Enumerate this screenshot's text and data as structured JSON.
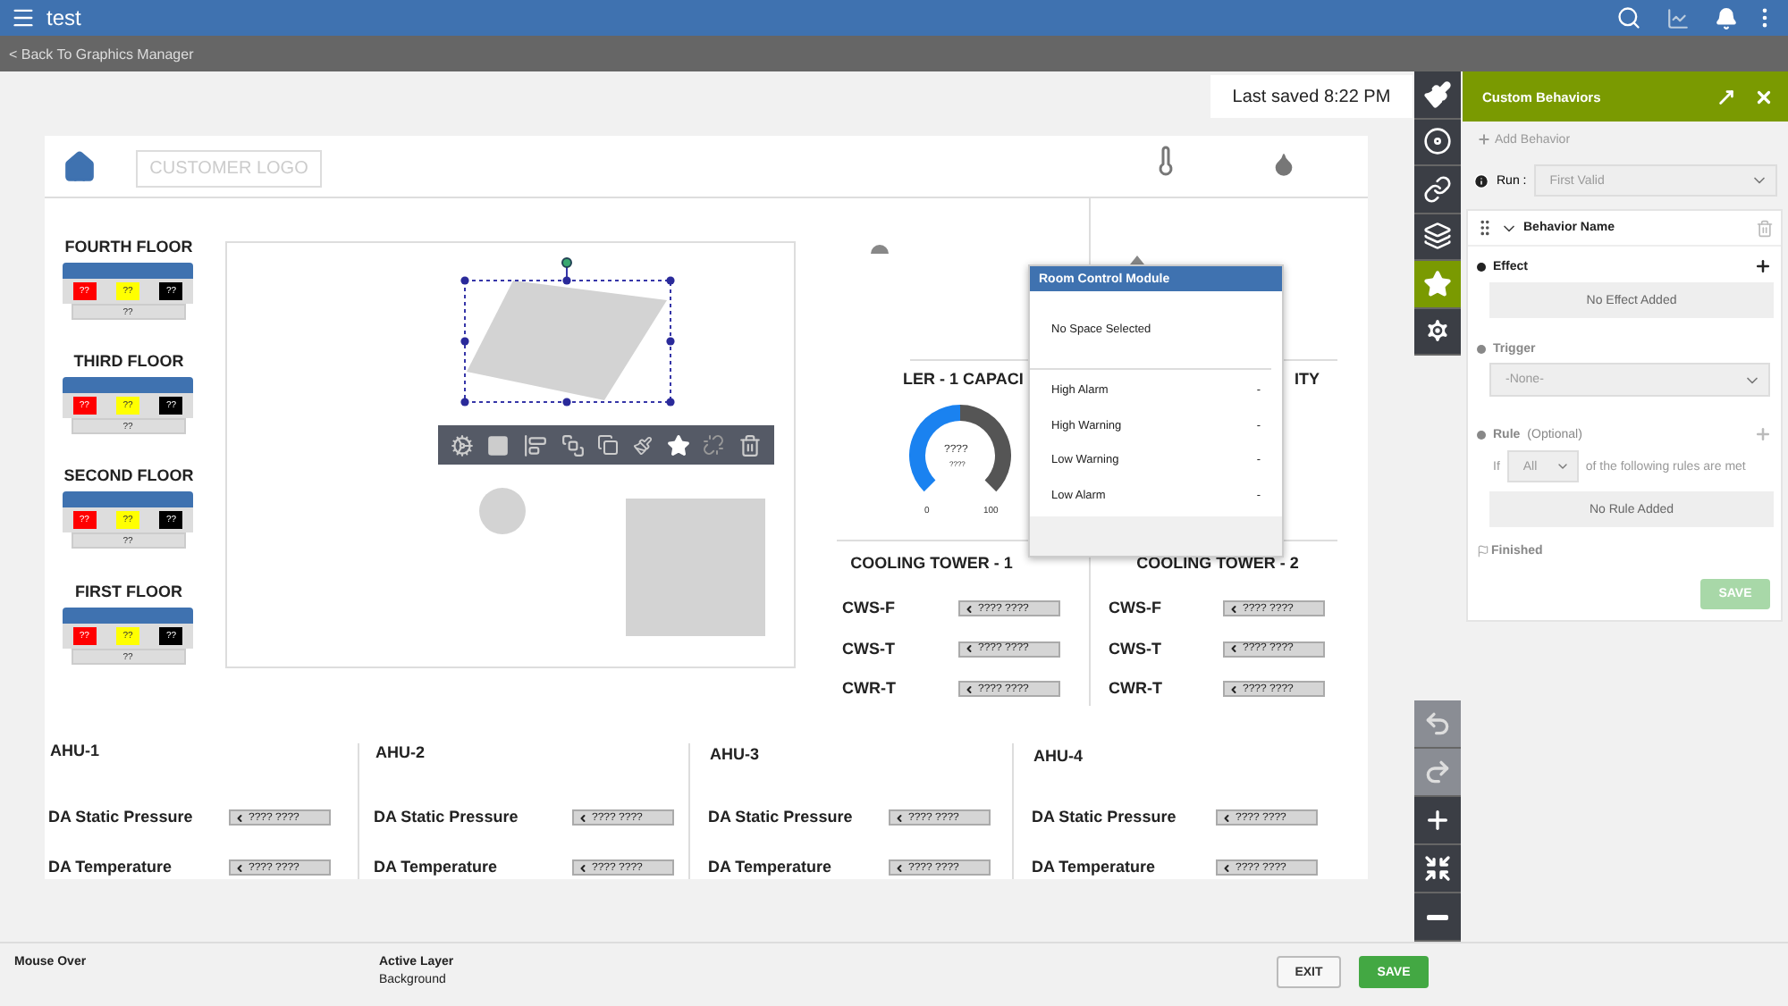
{
  "app_bar": {
    "title": "test"
  },
  "back_link": "< Back To Graphics Manager",
  "last_saved": "Last saved 8:22 PM",
  "canvas": {
    "logo": "CUSTOMER LOGO",
    "floors": [
      {
        "name": "FOURTH FLOOR",
        "bottom": "??",
        "cells": [
          {
            "text": "??",
            "color": "#ff0000"
          },
          {
            "text": "??",
            "color": "#ffff00"
          },
          {
            "text": "??",
            "color": "#000000"
          }
        ]
      },
      {
        "name": "THIRD FLOOR",
        "bottom": "??",
        "cells": [
          {
            "text": "??",
            "color": "#ff0000"
          },
          {
            "text": "??",
            "color": "#ffff00"
          },
          {
            "text": "??",
            "color": "#000000"
          }
        ]
      },
      {
        "name": "SECOND FLOOR",
        "bottom": "??",
        "cells": [
          {
            "text": "??",
            "color": "#ff0000"
          },
          {
            "text": "??",
            "color": "#ffff00"
          },
          {
            "text": "??",
            "color": "#000000"
          }
        ]
      },
      {
        "name": "FIRST FLOOR",
        "bottom": "??",
        "cells": [
          {
            "text": "??",
            "color": "#ff0000"
          },
          {
            "text": "??",
            "color": "#ffff00"
          },
          {
            "text": "??",
            "color": "#000000"
          }
        ]
      }
    ],
    "chiller_title_left": "LER - 1 CAPACI",
    "chiller_title_right": "ITY",
    "gauge": {
      "value": "????",
      "unit": "????",
      "min": "0",
      "max": "100",
      "level": 0.5
    },
    "towers": [
      {
        "title": "COOLING TOWER - 1",
        "rows": [
          {
            "label": "CWS-F",
            "value": "???? ????"
          },
          {
            "label": "CWS-T",
            "value": "???? ????"
          },
          {
            "label": "CWR-T",
            "value": "???? ????"
          }
        ]
      },
      {
        "title": "COOLING TOWER - 2",
        "rows": [
          {
            "label": "CWS-F",
            "value": "???? ????"
          },
          {
            "label": "CWS-T",
            "value": "???? ????"
          },
          {
            "label": "CWR-T",
            "value": "???? ????"
          }
        ]
      }
    ],
    "popup": {
      "title": "Room Control Module",
      "message": "No Space Selected",
      "rows": [
        {
          "label": "High Alarm",
          "value": "-"
        },
        {
          "label": "High Warning",
          "value": "-"
        },
        {
          "label": "Low Warning",
          "value": "-"
        },
        {
          "label": "Low Alarm",
          "value": "-"
        }
      ]
    },
    "ahus": [
      {
        "title": "AHU-1",
        "rows": [
          {
            "label": "DA Static Pressure",
            "value": "???? ????"
          },
          {
            "label": "DA Temperature",
            "value": "???? ????"
          }
        ]
      },
      {
        "title": "AHU-2",
        "rows": [
          {
            "label": "DA Static Pressure",
            "value": "???? ????"
          },
          {
            "label": "DA Temperature",
            "value": "???? ????"
          }
        ]
      },
      {
        "title": "AHU-3",
        "rows": [
          {
            "label": "DA Static Pressure",
            "value": "???? ????"
          },
          {
            "label": "DA Temperature",
            "value": "???? ????"
          }
        ]
      },
      {
        "title": "AHU-4",
        "rows": [
          {
            "label": "DA Static Pressure",
            "value": "???? ????"
          },
          {
            "label": "DA Temperature",
            "value": "???? ????"
          }
        ]
      }
    ]
  },
  "tools": [
    {
      "kind": "brush",
      "selected": false
    },
    {
      "kind": "ring",
      "selected": false
    },
    {
      "kind": "link",
      "selected": false
    },
    {
      "kind": "layers",
      "selected": false
    },
    {
      "kind": "star",
      "selected": true
    },
    {
      "kind": "settings",
      "selected": false
    }
  ],
  "view_tools": [
    {
      "kind": "undo",
      "disabled": true
    },
    {
      "kind": "redo",
      "disabled": true
    },
    {
      "kind": "zoom_in",
      "disabled": false
    },
    {
      "kind": "fit",
      "disabled": false
    },
    {
      "kind": "zoom_out",
      "disabled": false
    }
  ],
  "panel": {
    "title": "Custom Behaviors",
    "add_label": "Add Behavior",
    "run_label": "Run :",
    "run_value": "First Valid",
    "behavior_name": "Behavior Name",
    "effect_label": "Effect",
    "effect_empty": "No Effect Added",
    "trigger_label": "Trigger",
    "trigger_value": "-None-",
    "rule_label": "Rule",
    "rule_optional": "(Optional)",
    "rule_if": "If",
    "rule_match": "All",
    "rule_suffix": "of the following rules are met",
    "rule_empty": "No Rule Added",
    "finished_label": "Finished",
    "save_label": "SAVE",
    "save_disabled": true
  },
  "footer": {
    "mouse_over_label": "Mouse Over",
    "active_layer_label": "Active Layer",
    "active_layer_value": "Background",
    "exit": "EXIT",
    "save": "SAVE"
  }
}
